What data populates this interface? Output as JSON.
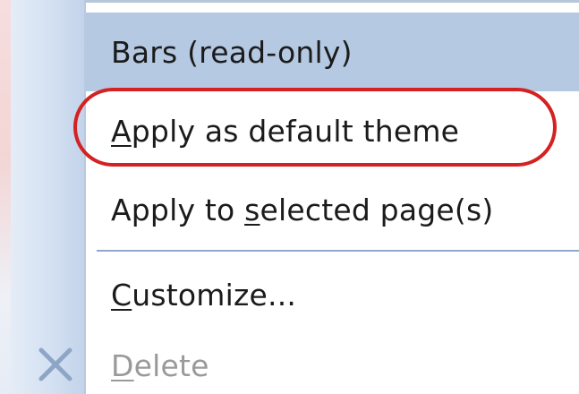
{
  "menu": {
    "items": [
      {
        "label": "Bars (read-only)",
        "state": "highlighted"
      },
      {
        "label_prefix": "",
        "mnemonic": "A",
        "label_rest": "pply as default theme",
        "state": "normal"
      },
      {
        "label_prefix": "Apply to ",
        "mnemonic": "s",
        "label_rest": "elected page(s)",
        "state": "normal"
      },
      {
        "label_prefix": "",
        "mnemonic": "C",
        "label_rest": "ustomize...",
        "state": "normal"
      },
      {
        "label_prefix": "",
        "mnemonic": "D",
        "label_rest": "elete",
        "state": "disabled",
        "icon": "close-x-icon"
      }
    ]
  },
  "annotation": {
    "shape": "oval",
    "color": "#d42121",
    "target_item": "Apply as default theme"
  },
  "colors": {
    "highlight": "#b5c9e3",
    "gutter": "#d4e1f2",
    "separator": "#8fa8cc",
    "disabled_text": "#9a9a9a"
  }
}
